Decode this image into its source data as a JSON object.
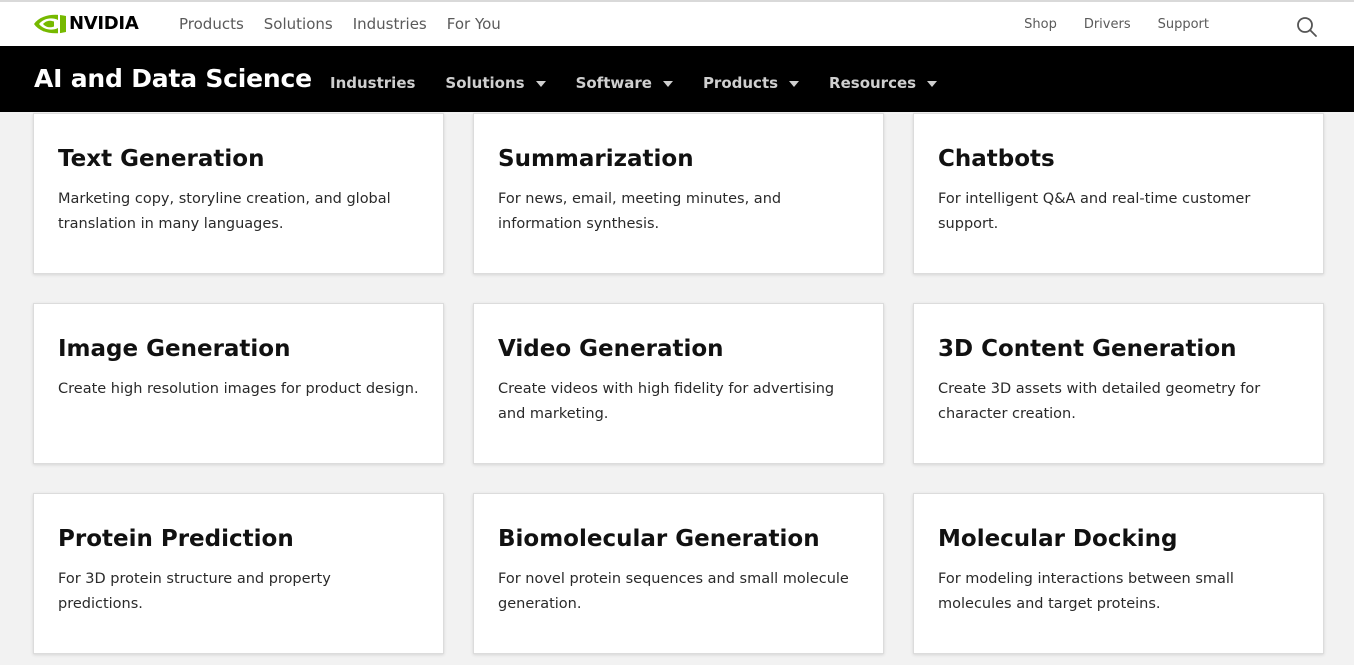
{
  "brand": {
    "name": "NVIDIA",
    "accent_color": "#76b900"
  },
  "global_nav": {
    "left": [
      "Products",
      "Solutions",
      "Industries",
      "For You"
    ],
    "right": [
      "Shop",
      "Drivers",
      "Support"
    ],
    "search_icon": "search-icon"
  },
  "section_nav": {
    "title": "AI and Data Science",
    "items": [
      {
        "label": "Industries",
        "dropdown": false
      },
      {
        "label": "Solutions",
        "dropdown": true
      },
      {
        "label": "Software",
        "dropdown": true
      },
      {
        "label": "Products",
        "dropdown": true
      },
      {
        "label": "Resources",
        "dropdown": true
      }
    ]
  },
  "cards": [
    {
      "title": "Text Generation",
      "description": "Marketing copy, storyline creation, and global translation in many languages."
    },
    {
      "title": "Summarization",
      "description": "For news, email, meeting minutes, and information synthesis."
    },
    {
      "title": "Chatbots",
      "description": "For intelligent Q&A and real-time customer support."
    },
    {
      "title": "Image Generation",
      "description": "Create high resolution images for product design."
    },
    {
      "title": "Video Generation",
      "description": "Create videos with high fidelity for advertising and marketing."
    },
    {
      "title": "3D Content Generation",
      "description": "Create 3D assets with detailed geometry for character creation."
    },
    {
      "title": "Protein Prediction",
      "description": "For 3D protein structure and property predictions."
    },
    {
      "title": "Biomolecular Generation",
      "description": "For novel protein sequences and small molecule generation."
    },
    {
      "title": "Molecular Docking",
      "description": "For modeling interactions between small molecules and target proteins."
    }
  ]
}
